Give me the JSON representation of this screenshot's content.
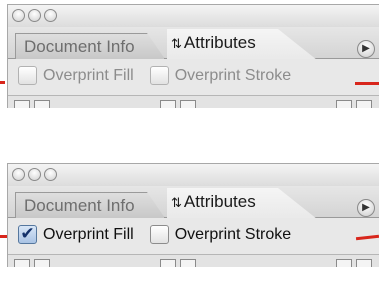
{
  "panels": [
    {
      "tabs": [
        {
          "label": "Document Info",
          "active": false
        },
        {
          "label": "Attributes",
          "active": true
        }
      ],
      "checkboxes": [
        {
          "label": "Overprint Fill",
          "checked": false,
          "enabled": false
        },
        {
          "label": "Overprint Stroke",
          "checked": false,
          "enabled": false
        }
      ]
    },
    {
      "tabs": [
        {
          "label": "Document Info",
          "active": false
        },
        {
          "label": "Attributes",
          "active": true
        }
      ],
      "checkboxes": [
        {
          "label": "Overprint Fill",
          "checked": true,
          "enabled": true
        },
        {
          "label": "Overprint Stroke",
          "checked": false,
          "enabled": true
        }
      ]
    }
  ],
  "glyphs": {
    "updown": "⇅",
    "check": "✔",
    "play": "▶"
  },
  "colors": {
    "annotation_red": "#d8261c",
    "checkbox_blue": "#5a7fb0"
  },
  "icons": [
    "close-light-icon",
    "minimize-light-icon",
    "zoom-light-icon",
    "updown-arrows-icon",
    "panel-menu-icon",
    "checkmark-icon",
    "align-icon"
  ]
}
